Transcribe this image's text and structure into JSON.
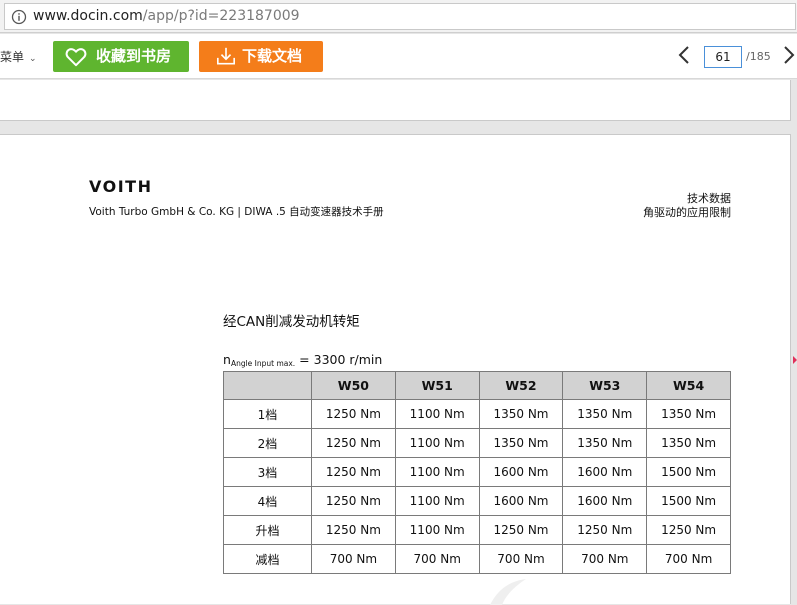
{
  "browser": {
    "url_host": "www.docin.com",
    "url_path": "/app/p?id=223187009"
  },
  "toolbar": {
    "menu_label": "菜单",
    "favorite_label": "收藏到书房",
    "download_label": "下载文档",
    "current_page": "61",
    "total_pages": "/185"
  },
  "colors": {
    "favorite_button": "#5fb52f",
    "download_button": "#f47d1a",
    "table_header_bg": "#d2d2d2"
  },
  "document": {
    "logo": "VOITH",
    "company_line": "Voith Turbo GmbH & Co. KG | DIWA .5 自动变速器技术手册",
    "header_right_1": "技术数据",
    "header_right_2": "角驱动的应用限制",
    "section_title": "经CAN削减发动机转矩",
    "formula_n": "n",
    "formula_sub": "Angle Input max.",
    "formula_value": " = 3300 r/min",
    "table": {
      "columns": [
        "",
        "W50",
        "W51",
        "W52",
        "W53",
        "W54"
      ],
      "rows": [
        [
          "1档",
          "1250 Nm",
          "1100 Nm",
          "1350 Nm",
          "1350 Nm",
          "1350 Nm"
        ],
        [
          "2档",
          "1250 Nm",
          "1100 Nm",
          "1350 Nm",
          "1350 Nm",
          "1350 Nm"
        ],
        [
          "3档",
          "1250 Nm",
          "1100 Nm",
          "1600 Nm",
          "1600 Nm",
          "1500 Nm"
        ],
        [
          "4档",
          "1250 Nm",
          "1100 Nm",
          "1600 Nm",
          "1600 Nm",
          "1500 Nm"
        ],
        [
          "升档",
          "1250 Nm",
          "1100 Nm",
          "1250 Nm",
          "1250 Nm",
          "1250 Nm"
        ],
        [
          "减档",
          "700 Nm",
          "700 Nm",
          "700 Nm",
          "700 Nm",
          "700 Nm"
        ]
      ]
    }
  }
}
